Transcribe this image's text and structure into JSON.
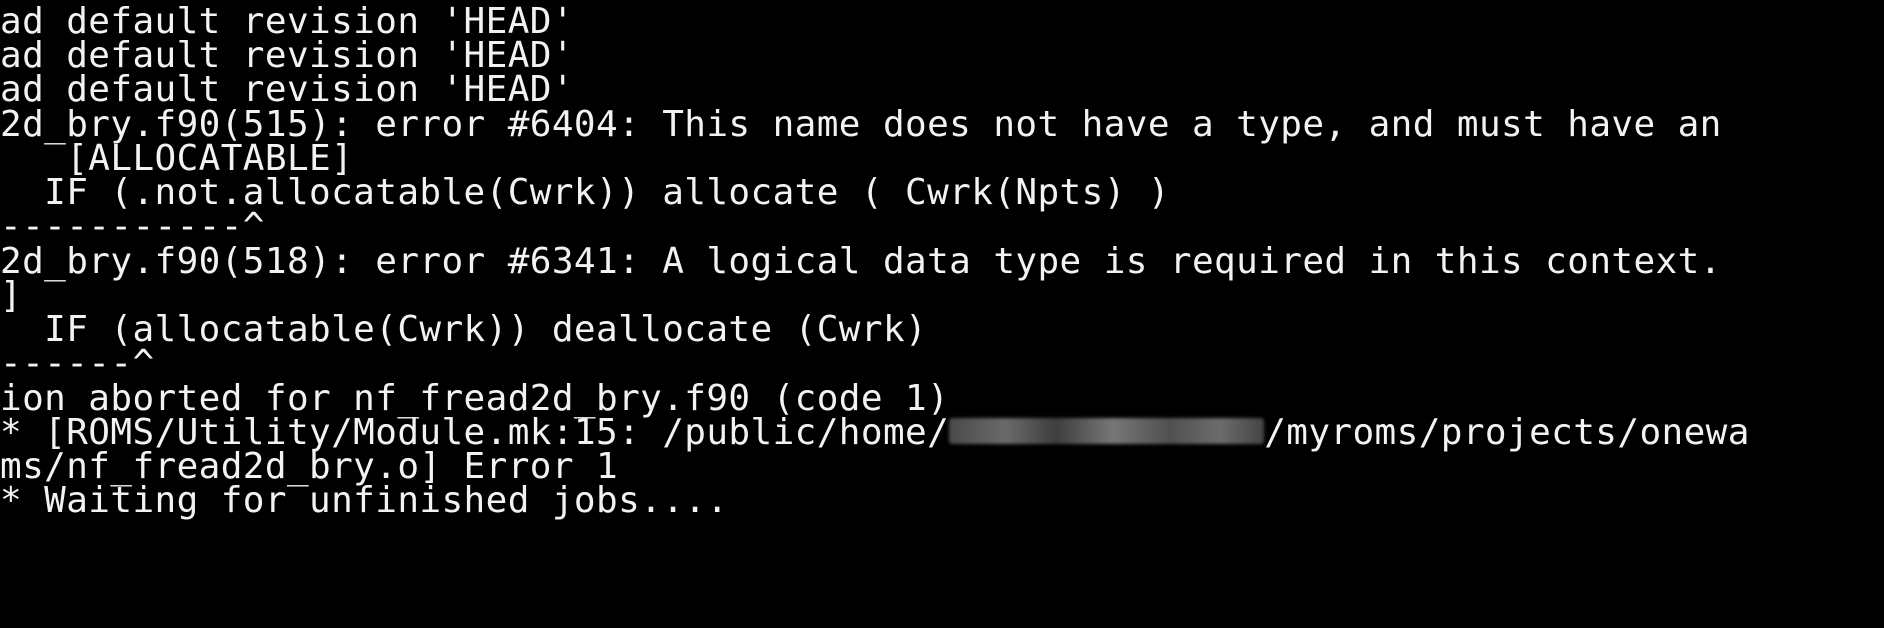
{
  "terminal": {
    "bg_color": "#000000",
    "fg_color": "#f2f2f2",
    "lines": [
      "ad default revision 'HEAD'",
      "ad default revision 'HEAD'",
      "ad default revision 'HEAD'",
      "2d_bry.f90(515): error #6404: This name does not have a type, and must have an",
      "   [ALLOCATABLE]",
      "  IF (.not.allocatable(Cwrk)) allocate ( Cwrk(Npts) )",
      "-----------^",
      "2d_bry.f90(518): error #6341: A logical data type is required in this context.",
      "]",
      "  IF (allocatable(Cwrk)) deallocate (Cwrk)",
      "------^",
      "ion aborted for nf_fread2d_bry.f90 (code 1)",
      "",
      "ms/nf_fread2d_bry.o] Error 1",
      "* Waiting for unfinished jobs...."
    ],
    "line12_prefix": "* [ROMS/Utility/Module.mk:15: /public/home/",
    "line12_suffix": "/myroms/projects/onewa"
  }
}
